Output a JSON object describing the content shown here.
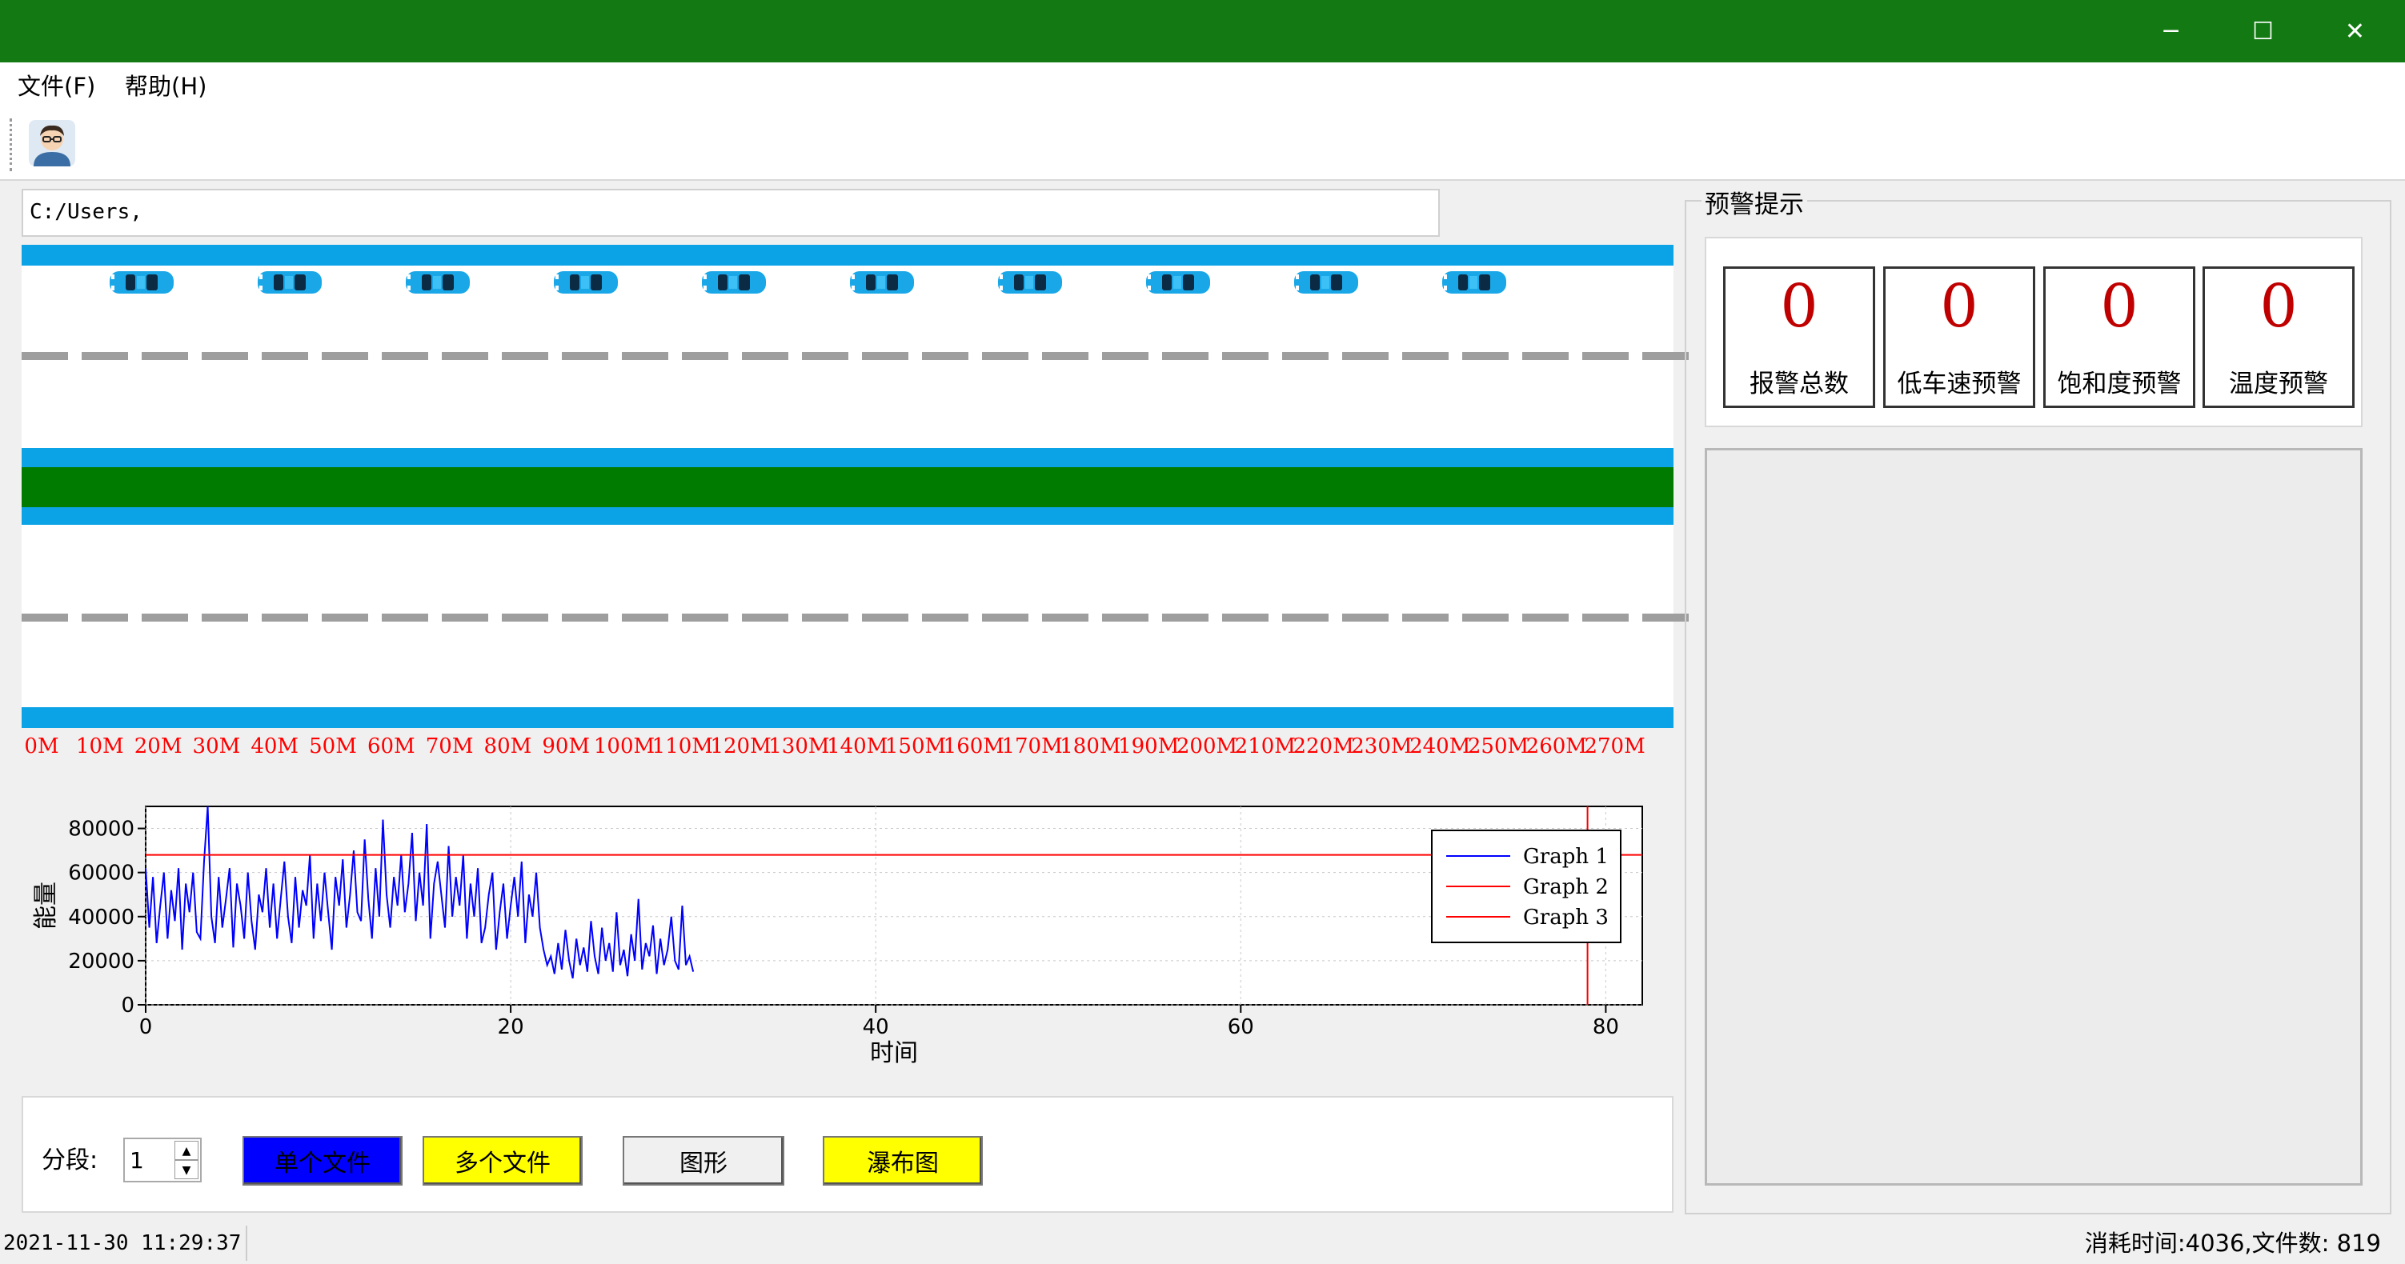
{
  "window": {
    "minimize": "─",
    "maximize": "☐",
    "close": "✕",
    "title_color": "#137a13"
  },
  "menu": {
    "file": "文件(F)",
    "help": "帮助(H)"
  },
  "toolbar": {
    "avatar_icon": "user-avatar-icon"
  },
  "path": {
    "value": "C:/Users,"
  },
  "road": {
    "lane_color": "#0ba3e6",
    "median_color": "#007b00",
    "car_count": 10,
    "meters": [
      "0M",
      "10M",
      "20M",
      "30M",
      "40M",
      "50M",
      "60M",
      "70M",
      "80M",
      "90M",
      "100M",
      "110M",
      "120M",
      "130M",
      "140M",
      "150M",
      "160M",
      "170M",
      "180M",
      "190M",
      "200M",
      "210M",
      "220M",
      "230M",
      "240M",
      "250M",
      "260M",
      "270M"
    ]
  },
  "chart_data": {
    "type": "line",
    "ylabel": "能量",
    "xlabel": "时间",
    "xlim": [
      0,
      82
    ],
    "ylim": [
      0,
      90000
    ],
    "xticks": [
      "0",
      "20",
      "40",
      "60",
      "80"
    ],
    "yticks": [
      "0",
      "20000",
      "40000",
      "60000",
      "80000"
    ],
    "series": [
      {
        "name": "Graph 1",
        "color": "#0000ff",
        "x": [
          0,
          0.2,
          0.4,
          0.6,
          0.8,
          1,
          1.2,
          1.4,
          1.6,
          1.8,
          2,
          2.2,
          2.4,
          2.6,
          2.8,
          3,
          3.2,
          3.4,
          3.6,
          3.8,
          4,
          4.2,
          4.4,
          4.6,
          4.8,
          5,
          5.2,
          5.4,
          5.6,
          5.8,
          6,
          6.2,
          6.4,
          6.6,
          6.8,
          7,
          7.2,
          7.4,
          7.6,
          7.8,
          8,
          8.2,
          8.4,
          8.6,
          8.8,
          9,
          9.2,
          9.4,
          9.6,
          9.8,
          10,
          10.2,
          10.4,
          10.6,
          10.8,
          11,
          11.2,
          11.4,
          11.6,
          11.8,
          12,
          12.2,
          12.4,
          12.6,
          12.8,
          13,
          13.2,
          13.4,
          13.6,
          13.8,
          14,
          14.2,
          14.4,
          14.6,
          14.8,
          15,
          15.2,
          15.4,
          15.6,
          15.8,
          16,
          16.2,
          16.4,
          16.6,
          16.8,
          17,
          17.2,
          17.4,
          17.6,
          17.8,
          18,
          18.2,
          18.4,
          18.6,
          18.8,
          19,
          19.2,
          19.4,
          19.6,
          19.8,
          20,
          20.2,
          20.4,
          20.6,
          20.8,
          21,
          21.2,
          21.4,
          21.6,
          21.8,
          22,
          22.2,
          22.4,
          22.6,
          22.8,
          23,
          23.2,
          23.4,
          23.6,
          23.8,
          24,
          24.2,
          24.4,
          24.6,
          24.8,
          25,
          25.2,
          25.4,
          25.6,
          25.8,
          26,
          26.2,
          26.4,
          26.6,
          26.8,
          27,
          27.2,
          27.4,
          27.6,
          27.8,
          28,
          28.2,
          28.4,
          28.6,
          28.8,
          29,
          29.2,
          29.4,
          29.6,
          29.8,
          30
        ],
        "y": [
          62000,
          35000,
          58000,
          28000,
          45000,
          60000,
          30000,
          52000,
          38000,
          62000,
          25000,
          55000,
          42000,
          60000,
          33000,
          30000,
          65000,
          90000,
          40000,
          28000,
          58000,
          35000,
          48000,
          62000,
          26000,
          55000,
          45000,
          30000,
          60000,
          38000,
          25000,
          50000,
          42000,
          62000,
          35000,
          55000,
          30000,
          48000,
          65000,
          40000,
          28000,
          58000,
          35000,
          52000,
          45000,
          68000,
          30000,
          55000,
          38000,
          60000,
          42000,
          25000,
          58000,
          45000,
          66000,
          35000,
          50000,
          70000,
          42000,
          38000,
          75000,
          48000,
          30000,
          62000,
          40000,
          84000,
          50000,
          35000,
          58000,
          45000,
          68000,
          42000,
          55000,
          78000,
          38000,
          60000,
          45000,
          82000,
          30000,
          55000,
          65000,
          50000,
          35000,
          72000,
          40000,
          58000,
          45000,
          68000,
          30000,
          55000,
          40000,
          62000,
          28000,
          35000,
          50000,
          60000,
          25000,
          42000,
          55000,
          30000,
          45000,
          58000,
          40000,
          65000,
          28000,
          50000,
          40000,
          60000,
          35000,
          25000,
          18000,
          22000,
          14000,
          28000,
          16000,
          34000,
          20000,
          12000,
          30000,
          18000,
          26000,
          15000,
          38000,
          22000,
          14000,
          35000,
          20000,
          28000,
          15000,
          42000,
          18000,
          25000,
          13000,
          32000,
          20000,
          48000,
          16000,
          28000,
          22000,
          36000,
          14000,
          30000,
          18000,
          25000,
          40000,
          20000,
          16000,
          45000,
          18000,
          22000,
          15000
        ]
      },
      {
        "name": "Graph 2",
        "color": "#ff0000",
        "y": 68000
      },
      {
        "name": "Graph 3",
        "color": "#ff0000",
        "x": 79
      }
    ],
    "legend": "top-right"
  },
  "controls": {
    "segment_label": "分段:",
    "segment_value": "1",
    "single_file": "单个文件",
    "multi_file": "多个文件",
    "graph": "图形",
    "waterfall": "瀑布图",
    "single_color": "#0000ff",
    "multi_color": "#ffff00",
    "waterfall_color": "#ffff00"
  },
  "warnings": {
    "title": "预警提示",
    "cards": [
      {
        "value": "0",
        "label": "报警总数"
      },
      {
        "value": "0",
        "label": "低车速预警"
      },
      {
        "value": "0",
        "label": "饱和度预警"
      },
      {
        "value": "0",
        "label": "温度预警"
      }
    ]
  },
  "status": {
    "datetime": "2021-11-30 11:29:37",
    "summary": "消耗时间:4036,文件数: 819"
  }
}
